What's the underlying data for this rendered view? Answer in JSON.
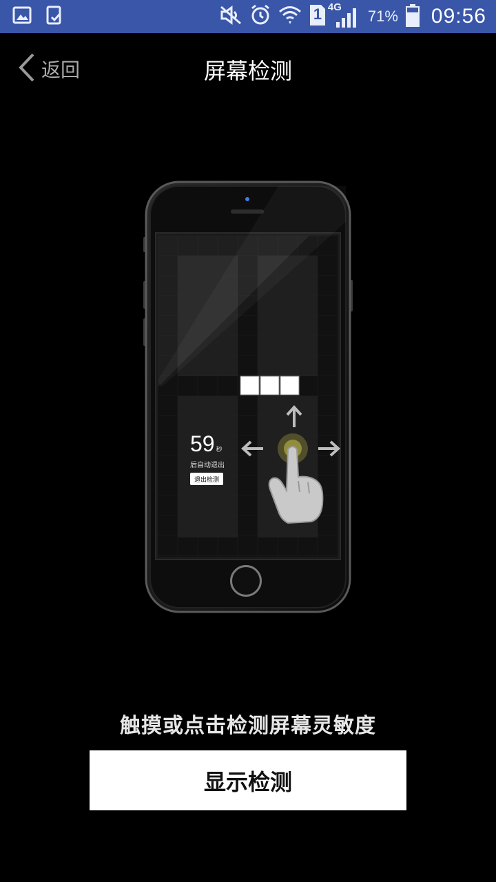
{
  "status_bar": {
    "signal_type": "4G",
    "sim_slot": "1",
    "battery": "71%",
    "time": "09:56",
    "icons": [
      "gallery-icon",
      "sync-phone-icon",
      "mute-icon",
      "alarm-icon",
      "wifi-icon",
      "sim-icon",
      "signal-icon",
      "battery-icon"
    ]
  },
  "nav": {
    "back_label": "返回",
    "title": "屏幕检测"
  },
  "illustration": {
    "countdown_value": "59",
    "countdown_unit": "秒",
    "auto_exit_text": "后自动退出",
    "exit_button_label": "退出检测"
  },
  "footer": {
    "hint": "触摸或点击检测屏幕灵敏度",
    "button_label": "显示检测"
  },
  "colors": {
    "status_bar_bg": "#3a56a8",
    "page_bg": "#000000",
    "button_bg": "#ffffff",
    "touch_dot": "#8f8a3a"
  }
}
